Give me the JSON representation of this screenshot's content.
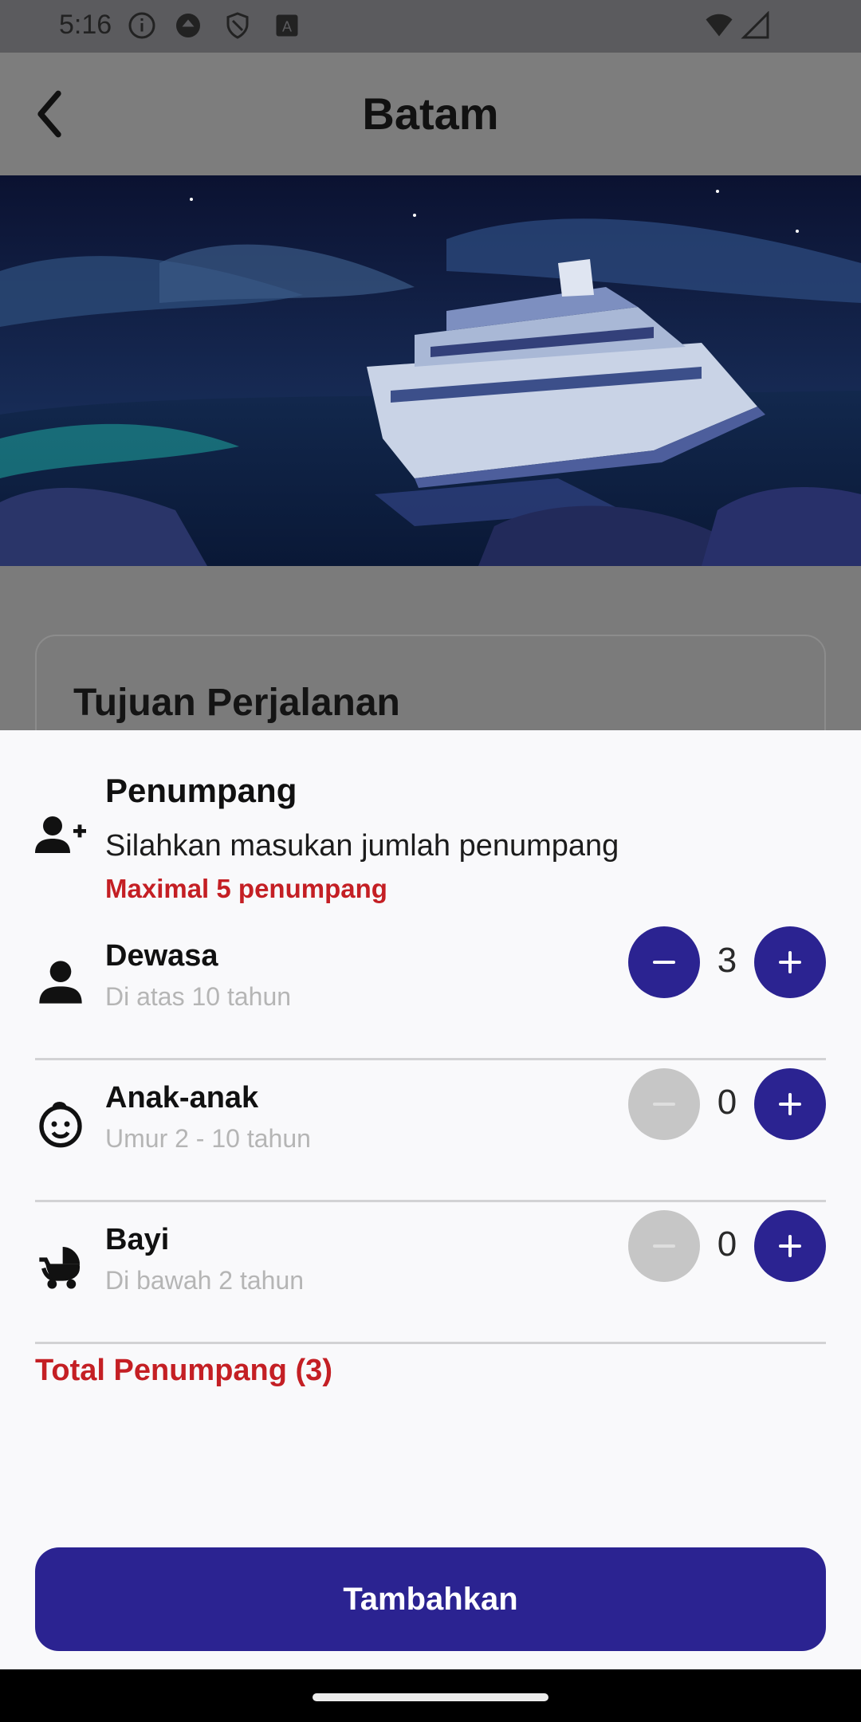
{
  "status_bar": {
    "time": "5:16",
    "icons": [
      "info-icon",
      "app-icon",
      "shield-icon",
      "autofill-icon",
      "wifi-icon",
      "signal-icon"
    ]
  },
  "header": {
    "title": "Batam",
    "back_icon": "back-arrow-icon"
  },
  "background_card": {
    "title": "Tujuan Perjalanan"
  },
  "sheet": {
    "header_icon": "person-add-icon",
    "title": "Penumpang",
    "subtitle": "Silahkan masukan jumlah penumpang",
    "max_note": "Maximal 5 penumpang",
    "rows": [
      {
        "icon": "person-icon",
        "label": "Dewasa",
        "sub": "Di atas 10 tahun",
        "count": "3",
        "minus_enabled": true,
        "plus_enabled": true
      },
      {
        "icon": "child-face-icon",
        "label": "Anak-anak",
        "sub": "Umur 2 - 10 tahun",
        "count": "0",
        "minus_enabled": false,
        "plus_enabled": true
      },
      {
        "icon": "stroller-icon",
        "label": "Bayi",
        "sub": "Di bawah 2 tahun",
        "count": "0",
        "minus_enabled": false,
        "plus_enabled": true
      }
    ],
    "total": "Total Penumpang (3)",
    "button": "Tambahkan"
  },
  "colors": {
    "primary": "#2b2391",
    "accent_red": "#c41f24",
    "disabled": "#c6c6c6"
  }
}
